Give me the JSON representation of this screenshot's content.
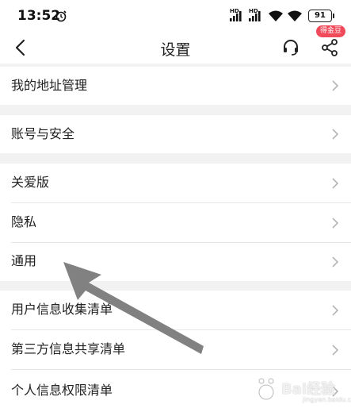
{
  "status": {
    "time": "13:52",
    "hd1": "HD",
    "hd2": "HD",
    "battery": "91"
  },
  "nav": {
    "title": "设置",
    "badge": "得金豆"
  },
  "groups": [
    {
      "items": [
        {
          "label": "我的地址管理"
        }
      ]
    },
    {
      "items": [
        {
          "label": "账号与安全"
        }
      ]
    },
    {
      "items": [
        {
          "label": "关爱版"
        },
        {
          "label": "隐私"
        },
        {
          "label": "通用"
        }
      ]
    },
    {
      "items": [
        {
          "label": "用户信息收集清单"
        },
        {
          "label": "第三方信息共享清单"
        },
        {
          "label": "个人信息权限清单"
        }
      ]
    }
  ],
  "watermark": {
    "logo": "Bai经验",
    "sub": "jingyan.baidu.com"
  },
  "colors": {
    "badge": "#f04a5b",
    "background": "#f2f2f2",
    "chevron": "#b5b5b5",
    "annotation_arrow": "#7a7a7a"
  }
}
